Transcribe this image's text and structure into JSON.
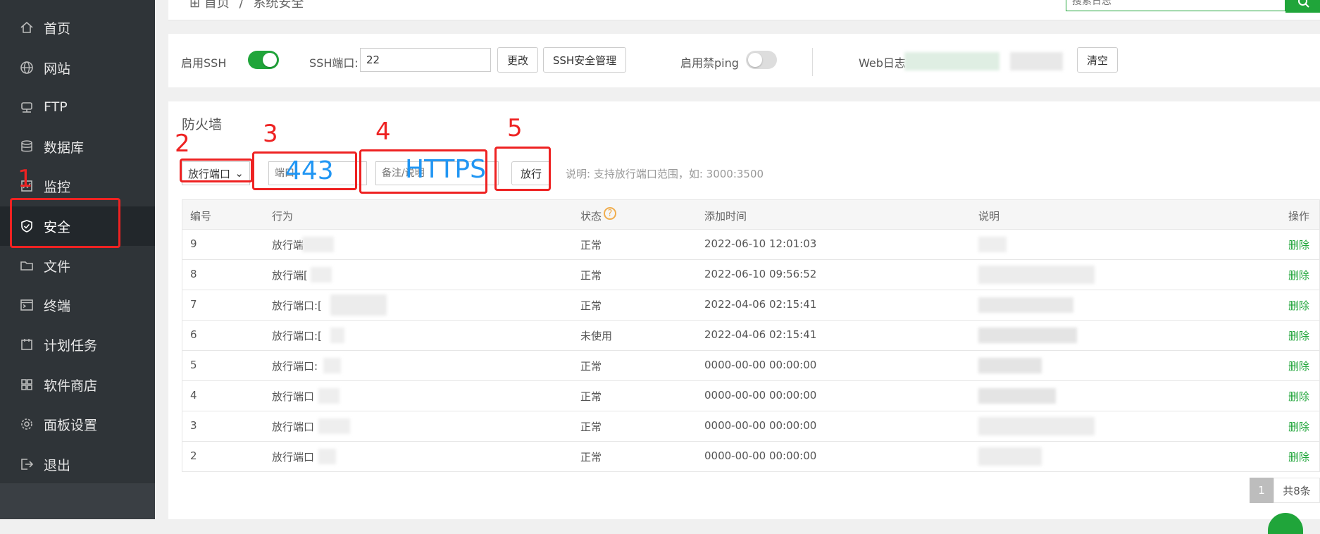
{
  "sidebar": {
    "items": [
      {
        "label": "首页",
        "icon": "home-icon"
      },
      {
        "label": "网站",
        "icon": "globe-icon"
      },
      {
        "label": "FTP",
        "icon": "ftp-icon"
      },
      {
        "label": "数据库",
        "icon": "database-icon"
      },
      {
        "label": "监控",
        "icon": "monitor-icon"
      },
      {
        "label": "安全",
        "icon": "shield-icon"
      },
      {
        "label": "文件",
        "icon": "folder-icon"
      },
      {
        "label": "终端",
        "icon": "terminal-icon"
      },
      {
        "label": "计划任务",
        "icon": "calendar-icon"
      },
      {
        "label": "软件商店",
        "icon": "grid-icon"
      },
      {
        "label": "面板设置",
        "icon": "gear-icon"
      },
      {
        "label": "退出",
        "icon": "logout-icon"
      }
    ],
    "active": "安全"
  },
  "breadcrumb": {
    "home": "首页",
    "separator": "/",
    "current": "系统安全"
  },
  "search": {
    "placeholder": "搜索日志"
  },
  "ssh": {
    "enable_label": "启用SSH",
    "port_label": "SSH端口:",
    "port_value": "22",
    "change_button": "更改",
    "manage_button": "SSH安全管理",
    "ping_label": "启用禁ping",
    "weblog_label": "Web日志",
    "clear_button": "清空"
  },
  "firewall": {
    "title": "防火墙",
    "mode_select": "放行端口",
    "port_placeholder": "端口",
    "note_placeholder": "备注/说明",
    "allow_button": "放行",
    "hint": "说明: 支持放行端口范围，如: 3000:3500"
  },
  "table": {
    "headers": {
      "id": "编号",
      "action": "行为",
      "status": "状态",
      "time": "添加时间",
      "desc": "说明",
      "op": "操作"
    },
    "rows": [
      {
        "id": "9",
        "action": "放行端",
        "status": "正常",
        "time": "2022-06-10 12:01:03",
        "op": "删除"
      },
      {
        "id": "8",
        "action": "放行端[",
        "status": "正常",
        "time": "2022-06-10 09:56:52",
        "op": "删除"
      },
      {
        "id": "7",
        "action": "放行端口:[",
        "status": "正常",
        "time": "2022-04-06 02:15:41",
        "op": "删除"
      },
      {
        "id": "6",
        "action": "放行端口:[",
        "status": "未使用",
        "time": "2022-04-06 02:15:41",
        "op": "删除"
      },
      {
        "id": "5",
        "action": "放行端口:",
        "status": "正常",
        "time": "0000-00-00 00:00:00",
        "op": "删除"
      },
      {
        "id": "4",
        "action": "放行端口",
        "status": "正常",
        "time": "0000-00-00 00:00:00",
        "op": "删除"
      },
      {
        "id": "3",
        "action": "放行端口",
        "status": "正常",
        "time": "0000-00-00 00:00:00",
        "op": "删除"
      },
      {
        "id": "2",
        "action": "放行端口",
        "status": "正常",
        "time": "0000-00-00 00:00:00",
        "op": "删除"
      }
    ]
  },
  "pager": {
    "current": "1",
    "total": "共8条"
  },
  "annotations": {
    "numbers": [
      "1",
      "2",
      "3",
      "4",
      "5"
    ],
    "port_text": "443",
    "note_text": "HTTPS"
  },
  "colors": {
    "accent": "#20a53a",
    "sidebar": "#2f3438",
    "annotation": "#ee2222",
    "annotation_text": "#2196f3"
  }
}
